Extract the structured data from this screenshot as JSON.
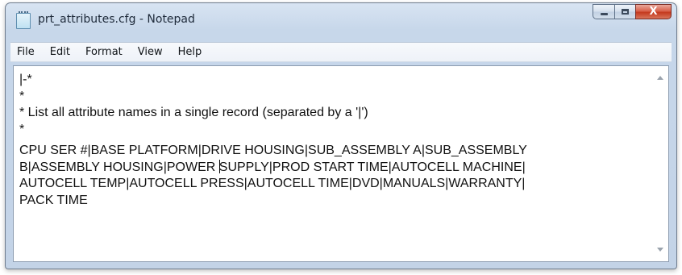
{
  "window": {
    "title": "prt_attributes.cfg - Notepad",
    "icon": "notepad-icon",
    "caption_buttons": {
      "minimize_icon": "minimize-icon",
      "maximize_icon": "maximize-icon",
      "close_glyph": "X"
    }
  },
  "menu": {
    "items": [
      "File",
      "Edit",
      "Format",
      "View",
      "Help"
    ]
  },
  "editor": {
    "lines": [
      "|-*",
      "*",
      "* List all attribute names in a single record (separated by a '|')",
      "*"
    ],
    "record_lines": [
      "CPU SER #|BASE PLATFORM|DRIVE HOUSING|SUB_ASSEMBLY A|SUB_ASSEMBLY",
      "B|ASSEMBLY HOUSING|POWER ",
      "SUPPLY|PROD START TIME|AUTOCELL MACHINE|",
      "AUTOCELL TEMP|AUTOCELL PRESS|AUTOCELL TIME|DVD|MANUALS|WARRANTY|",
      "PACK TIME"
    ]
  },
  "colors": {
    "frame": "#c7d7ea",
    "close_button": "#c4391e",
    "text": "#111111"
  }
}
